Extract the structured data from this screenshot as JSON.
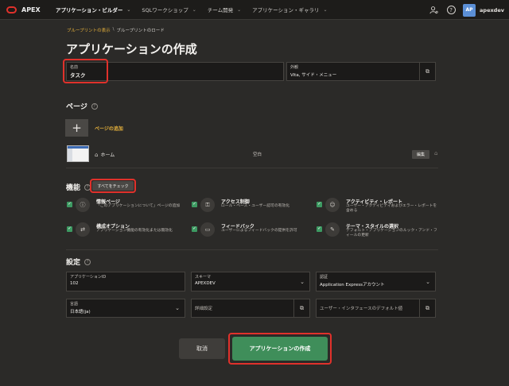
{
  "topbar": {
    "app_name": "APEX",
    "nav": [
      {
        "label": "アプリケーション・ビルダー"
      },
      {
        "label": "SQLワークショップ"
      },
      {
        "label": "チーム開発"
      },
      {
        "label": "アプリケーション・ギャラリ"
      }
    ],
    "user_initials": "AP",
    "username": "apexdev",
    "help_glyph": "?"
  },
  "breadcrumb": {
    "link": "ブループリントの表示",
    "current": "ブループリントのロード"
  },
  "page_title": "アプリケーションの作成",
  "name_field": {
    "label": "名前",
    "value": "タスク"
  },
  "appearance_field": {
    "label": "外観",
    "value": "Vita, サイド・メニュー"
  },
  "pages_section": {
    "title": "ページ",
    "add_label": "ページの追加",
    "add_glyph": "+",
    "rows": [
      {
        "name": "ホーム",
        "type": "空白",
        "edit_label": "編集"
      }
    ]
  },
  "features_section": {
    "title": "機能",
    "check_all_label": "すべてをチェック",
    "checkmark": "✓",
    "items": [
      {
        "title": "情報ページ",
        "desc": "「このアプリケーションについて」ページの追加",
        "icon": "info-icon",
        "glyph": "ⓘ"
      },
      {
        "title": "アクセス制御",
        "desc": "ロール・ベース・ユーザー認可の有効化",
        "icon": "key-icon",
        "glyph": "⚿"
      },
      {
        "title": "アクティビティ・レポート",
        "desc": "ユーザー・アクティビティおよびエラー・レポートを含める",
        "icon": "user-report-icon",
        "glyph": "☺"
      },
      {
        "title": "構成オプション",
        "desc": "アプリケーション機能の有効化または無効化",
        "icon": "toggle-icon",
        "glyph": "⇄"
      },
      {
        "title": "フィードバック",
        "desc": "ユーザーによるフィードバックの提供を許可",
        "icon": "chat-icon",
        "glyph": "▭"
      },
      {
        "title": "テーマ・スタイルの選択",
        "desc": "デフォルト・アプリケーションのルック・アンド・フィールの更新",
        "icon": "brush-icon",
        "glyph": "✎"
      }
    ]
  },
  "settings_section": {
    "title": "設定",
    "app_id": {
      "label": "アプリケーションID",
      "value": "102"
    },
    "schema": {
      "label": "スキーマ",
      "value": "APEXDEV"
    },
    "auth": {
      "label": "認証",
      "value": "Application Expressアカウント"
    },
    "language": {
      "label": "言語",
      "value": "日本語(ja)"
    },
    "advanced_placeholder": "詳細設定",
    "ui_defaults_placeholder": "ユーザー・インタフェースのデフォルト値"
  },
  "actions": {
    "cancel": "取消",
    "create": "アプリケーションの作成"
  },
  "colors": {
    "accent_link": "#e8b33c",
    "primary_button": "#3f8e5a",
    "highlight": "#e0312b"
  }
}
